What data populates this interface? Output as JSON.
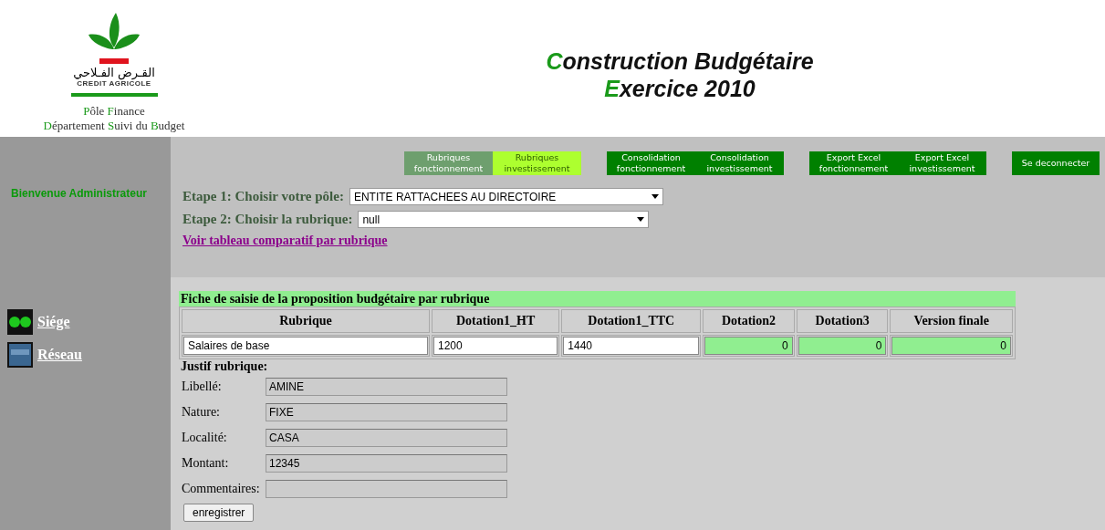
{
  "logo": {
    "arabic": "القـرض الفـلاحي",
    "name": "CREDIT AGRICOLE"
  },
  "department": [
    [
      {
        "text": "Pôle",
        "accent": true
      },
      {
        "text": "Finance",
        "accent": true
      }
    ],
    [
      {
        "text": "Département",
        "accent": true
      },
      {
        "text": "Suivi",
        "accent": true
      },
      {
        "text": "du",
        "accent": false
      },
      {
        "text": "Budget",
        "accent": true
      }
    ]
  ],
  "title": [
    [
      {
        "text": "Construction",
        "accent": true
      },
      {
        "text": "Budgétaire",
        "accent": false
      }
    ],
    [
      {
        "text": "Exercice",
        "accent": true
      },
      {
        "text": "2010",
        "accent": false
      }
    ]
  ],
  "nav_groups": [
    [
      {
        "label": "Rubriques fonctionnement",
        "selected": false,
        "kind": "muted"
      },
      {
        "label": "Rubriques investissement",
        "selected": true,
        "kind": "muted"
      }
    ],
    [
      {
        "label": "Consolidation fonctionnement",
        "selected": false,
        "kind": "plain"
      },
      {
        "label": "Consolidation investissement",
        "selected": false,
        "kind": "plain"
      }
    ],
    [
      {
        "label": "Export Excel fonctionnement",
        "selected": false,
        "kind": "plain"
      },
      {
        "label": "Export Excel investissement",
        "selected": false,
        "kind": "plain"
      }
    ],
    [
      {
        "label": "Se deconnecter",
        "selected": false,
        "kind": "plain"
      }
    ]
  ],
  "sidebar": {
    "welcome": "Bienvenue Administrateur",
    "links": [
      {
        "label": "Siége",
        "kind": "dots"
      },
      {
        "label": "Réseau",
        "kind": "tile"
      }
    ]
  },
  "steps": [
    {
      "label": "Etape 1: Choisir votre pôle:",
      "value": "ENTITE RATTACHEES AU DIRECTOIRE",
      "wide": true
    },
    {
      "label": "Etape 2: Choisir la rubrique:",
      "value": "null",
      "wide": false
    }
  ],
  "compare_link": "Voir tableau comparatif par rubrique",
  "form": {
    "title": "Fiche de saisie de la proposition budgétaire par rubrique",
    "columns": [
      "Rubrique",
      "Dotation1_HT",
      "Dotation1_TTC",
      "Dotation2",
      "Dotation3",
      "Version finale"
    ],
    "row": [
      {
        "value": "Salaires de base",
        "readonly": false
      },
      {
        "value": "1200",
        "readonly": false
      },
      {
        "value": "1440",
        "readonly": false
      },
      {
        "value": "0",
        "readonly": true
      },
      {
        "value": "0",
        "readonly": true
      },
      {
        "value": "0",
        "readonly": true
      }
    ],
    "justif_title": "Justif rubrique:",
    "justif": [
      {
        "label": "Libellé:",
        "value": "AMINE"
      },
      {
        "label": "Nature:",
        "value": "FIXE"
      },
      {
        "label": "Localité:",
        "value": "CASA"
      },
      {
        "label": "Montant:",
        "value": "12345"
      },
      {
        "label": "Commentaires:"
      }
    ],
    "save": "enregistrer"
  }
}
